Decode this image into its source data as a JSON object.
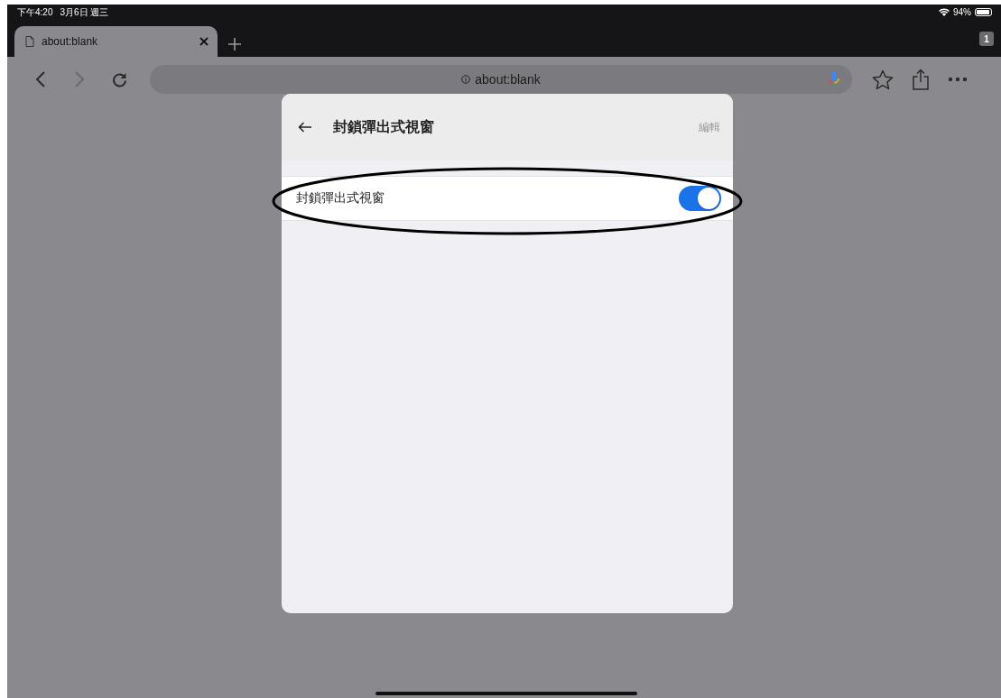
{
  "status_bar": {
    "time": "下午4:20",
    "date": "3月6日 週三",
    "battery": "94%"
  },
  "tabs": [
    {
      "title": "about:blank",
      "selected": true
    }
  ],
  "tab_count": "1",
  "address_bar": {
    "url": "about:blank"
  },
  "dialog": {
    "title": "封鎖彈出式視窗",
    "edit": {
      "label": "編輯",
      "disabled": true
    },
    "rows": [
      {
        "label": "封鎖彈出式視窗",
        "on": true
      }
    ]
  }
}
